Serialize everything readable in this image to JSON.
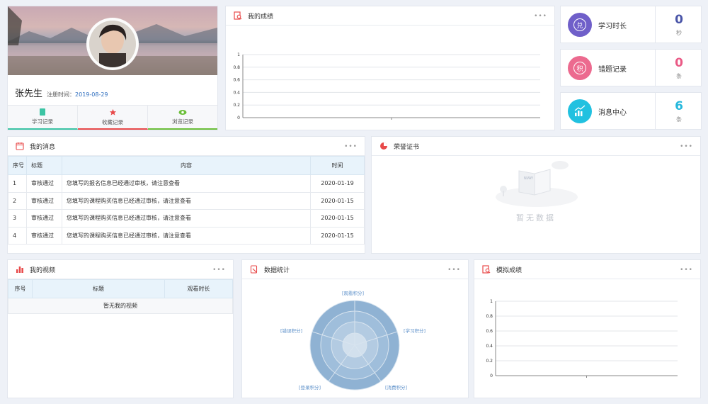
{
  "profile": {
    "name": "张先生",
    "reg_label": "注册时间：",
    "reg_date": "2019-08-29",
    "tabs": [
      {
        "label": "学习记录",
        "icon": "book-icon",
        "color": "#3cc4a4"
      },
      {
        "label": "收藏记录",
        "icon": "star-icon",
        "color": "#e84a4a"
      },
      {
        "label": "浏览记录",
        "icon": "eye-icon",
        "color": "#6bbf3a"
      }
    ]
  },
  "scores": {
    "title": "我的成绩",
    "more": "•••",
    "y_ticks": [
      "1",
      "0.8",
      "0.6",
      "0.4",
      "0.2",
      "0"
    ]
  },
  "stats": [
    {
      "label": "学习时长",
      "value": "0",
      "unit": "秒",
      "icon": "exchange-icon",
      "icon_text": "兑",
      "color": "#6f5fc9",
      "value_color": "#4a55a8"
    },
    {
      "label": "错题记录",
      "value": "0",
      "unit": "条",
      "icon": "points-icon",
      "icon_text": "积",
      "color": "#ec6a8f",
      "value_color": "#ea5a86"
    },
    {
      "label": "消息中心",
      "value": "6",
      "unit": "条",
      "icon": "growth-chart-icon",
      "icon_text": "",
      "color": "#21c1e0",
      "value_color": "#26b8dc"
    }
  ],
  "messages": {
    "title": "我的消息",
    "more": "•••",
    "columns": [
      "序号",
      "标题",
      "内容",
      "时间"
    ],
    "rows": [
      {
        "no": "1",
        "title": "审核通过",
        "content": "您填写的报名信息已经通过审核，请注意查看",
        "time": "2020-01-19"
      },
      {
        "no": "2",
        "title": "审核通过",
        "content": "您填写的课程购买信息已经通过审核，请注意查看",
        "time": "2020-01-15"
      },
      {
        "no": "3",
        "title": "审核通过",
        "content": "您填写的课程购买信息已经通过审核，请注意查看",
        "time": "2020-01-15"
      },
      {
        "no": "4",
        "title": "审核通过",
        "content": "您填写的课程购买信息已经通过审核，请注意查看",
        "time": "2020-01-15"
      }
    ]
  },
  "honor": {
    "title": "荣誉证书",
    "more": "•••",
    "empty": "暂无数据",
    "book_text": "NVAY"
  },
  "videos": {
    "title": "我的视频",
    "more": "•••",
    "columns": [
      "序号",
      "标题",
      "观看时长"
    ],
    "empty": "暂无我的视频"
  },
  "radar": {
    "title": "数据统计",
    "more": "•••",
    "labels": [
      "[观看积分]",
      "[学习积分]",
      "[消费积分]",
      "[登录积分]",
      "[错误积分]"
    ]
  },
  "mock": {
    "title": "模拟成绩",
    "more": "•••",
    "y_ticks": [
      "1",
      "0.8",
      "0.6",
      "0.4",
      "0.2",
      "0"
    ]
  }
}
